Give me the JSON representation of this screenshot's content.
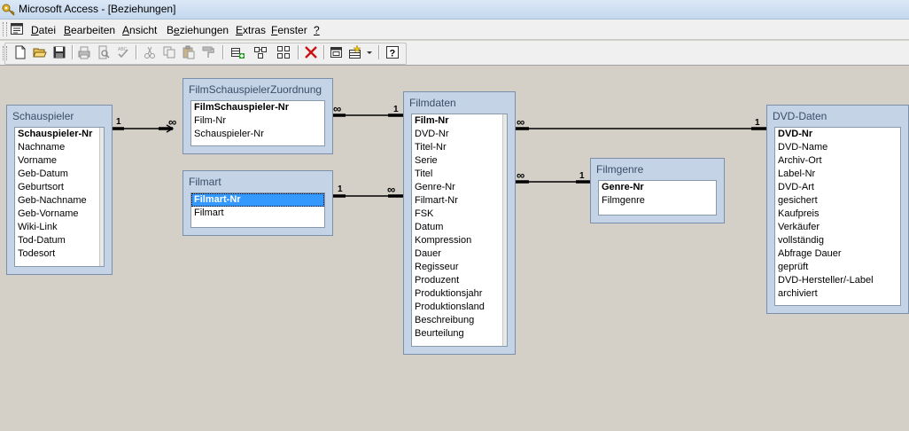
{
  "window": {
    "title": "Microsoft Access - [Beziehungen]"
  },
  "menu": [
    {
      "mn": "D",
      "rest": "atei"
    },
    {
      "mn": "B",
      "rest": "earbeiten"
    },
    {
      "mn": "A",
      "rest": "nsicht"
    },
    {
      "mn": "Be",
      "rest": "ziehungen",
      "underline_index": 1
    },
    {
      "mn": "E",
      "rest": "xtras"
    },
    {
      "mn": "F",
      "rest": "enster"
    },
    {
      "mn": "?",
      "rest": ""
    }
  ],
  "toolbar": {
    "icons": [
      "new-icon",
      "open-icon",
      "save-icon",
      "print-icon",
      "print-preview-icon",
      "spelling-icon",
      "cut-icon",
      "copy-icon",
      "paste-icon",
      "format-painter-icon",
      "show-table-icon",
      "show-direct-icon",
      "show-all-icon",
      "delete-icon",
      "new-object-icon",
      "new-object-dropdown-icon",
      "help-icon"
    ]
  },
  "tables": {
    "schauspieler": {
      "title": "Schauspieler",
      "fields": [
        "Schauspieler-Nr",
        "Nachname",
        "Vorname",
        "Geb-Datum",
        "Geburtsort",
        "Geb-Nachname",
        "Geb-Vorname",
        "Wiki-Link",
        "Tod-Datum",
        "Todesort"
      ]
    },
    "zuordnung": {
      "title": "FilmSchauspielerZuordnung",
      "fields": [
        "FilmSchauspieler-Nr",
        "Film-Nr",
        "Schauspieler-Nr"
      ]
    },
    "filmart": {
      "title": "Filmart",
      "fields": [
        "Filmart-Nr",
        "Filmart"
      ]
    },
    "filmdaten": {
      "title": "Filmdaten",
      "fields": [
        "Film-Nr",
        "DVD-Nr",
        "Titel-Nr",
        "Serie",
        "Titel",
        "Genre-Nr",
        "Filmart-Nr",
        "FSK",
        "Datum",
        "Kompression",
        "Dauer",
        "Regisseur",
        "Produzent",
        "Produktionsjahr",
        "Produktionsland",
        "Beschreibung",
        "Beurteilung"
      ]
    },
    "filmgenre": {
      "title": "Filmgenre",
      "fields": [
        "Genre-Nr",
        "Filmgenre"
      ]
    },
    "dvddaten": {
      "title": "DVD-Daten",
      "fields": [
        "DVD-Nr",
        "DVD-Name",
        "Archiv-Ort",
        "Label-Nr",
        "DVD-Art",
        "gesichert",
        "Kaufpreis",
        "Verkäufer",
        "vollständig",
        "Abfrage Dauer",
        "geprüft",
        "DVD-Hersteller/-Label",
        "archiviert"
      ]
    }
  },
  "relationships": {
    "one": "1",
    "many": "∞"
  },
  "colors": {
    "table_frame": "#c5d3e6",
    "selection": "#3399ff",
    "workspace": "#d4d0c8"
  }
}
